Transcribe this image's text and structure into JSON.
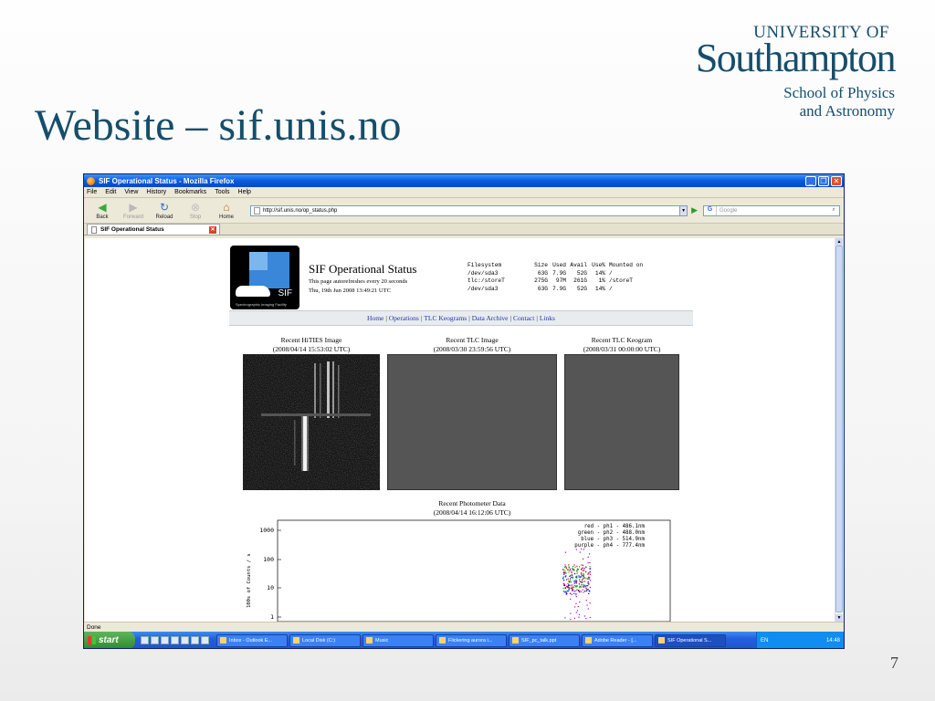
{
  "slide": {
    "title": "Website – sif.unis.no",
    "logo": {
      "line1": "UNIVERSITY OF",
      "line2": "Southampton",
      "line3": "School of Physics",
      "line4": "and Astronomy"
    },
    "page_number": "7"
  },
  "browser": {
    "window_title": "SIF Operational Status - Mozilla Firefox",
    "menu": [
      "File",
      "Edit",
      "View",
      "History",
      "Bookmarks",
      "Tools",
      "Help"
    ],
    "nav": {
      "back": "Back",
      "forward": "Forward",
      "reload": "Reload",
      "stop": "Stop",
      "home": "Home"
    },
    "url": "http://sif.unis.no/op_status.php",
    "search_placeholder": "Google",
    "tab_label": "SIF Operational Status",
    "status_text": "Done"
  },
  "page": {
    "title": "SIF Operational Status",
    "refresh_note": "This page autorefreshes every 20 seconds",
    "timestamp": "Thu, 19th Jun 2008 13:49:21 UTC",
    "logo_text": "SIF",
    "logo_subtext": "Spectrographic Imaging Facility",
    "filesystem_table": {
      "headers": [
        "Filesystem",
        "Size",
        "Used",
        "Avail",
        "Use%",
        "Mounted on"
      ],
      "rows": [
        [
          "/dev/sda3",
          "63G",
          "7.9G",
          "52G",
          "14%",
          "/"
        ],
        [
          "tlc:/storeT",
          "275G",
          "97M",
          "261G",
          "1%",
          "/storeT"
        ],
        [
          "/dev/sda3",
          "63G",
          "7.9G",
          "52G",
          "14%",
          "/"
        ]
      ]
    },
    "nav_links": [
      "Home",
      "Operations",
      "TLC Keograms",
      "Data Archive",
      "Contact",
      "Links"
    ],
    "panels": [
      {
        "title": "Recent HiTIES Image",
        "time": "(2008/04/14 15:53:02 UTC)"
      },
      {
        "title": "Recent TLC Image",
        "time": "(2008/03/30 23:59:56 UTC)"
      },
      {
        "title": "Recent TLC Keogram",
        "time": "(2008/03/31 00:00:00 UTC)"
      }
    ],
    "photometer": {
      "title": "Recent Photometer Data",
      "time": "(2008/04/14 16:12:06 UTC)",
      "y_ticks": [
        "1000",
        "100",
        "10",
        "1"
      ],
      "ylabel": "100s of Counts / s",
      "legend": [
        {
          "text": "red - ph1 - 486.1nm",
          "color": "#e00000"
        },
        {
          "text": "green - ph2 - 488.0nm",
          "color": "#00b000"
        },
        {
          "text": "blue - ph3 - 514.9nm",
          "color": "#0000e0"
        },
        {
          "text": "purple - ph4 - 777.4nm",
          "color": "#c000c0"
        }
      ]
    }
  },
  "taskbar": {
    "start_label": "start",
    "items": [
      "Inbox - Outlook E...",
      "Local Disk (C:)",
      "Music",
      "Flickering aurora i...",
      "SIF_pc_talk.ppt",
      "Adobe Reader - [...",
      "SIF Operational S..."
    ],
    "lang": "EN",
    "clock": "14:48"
  }
}
